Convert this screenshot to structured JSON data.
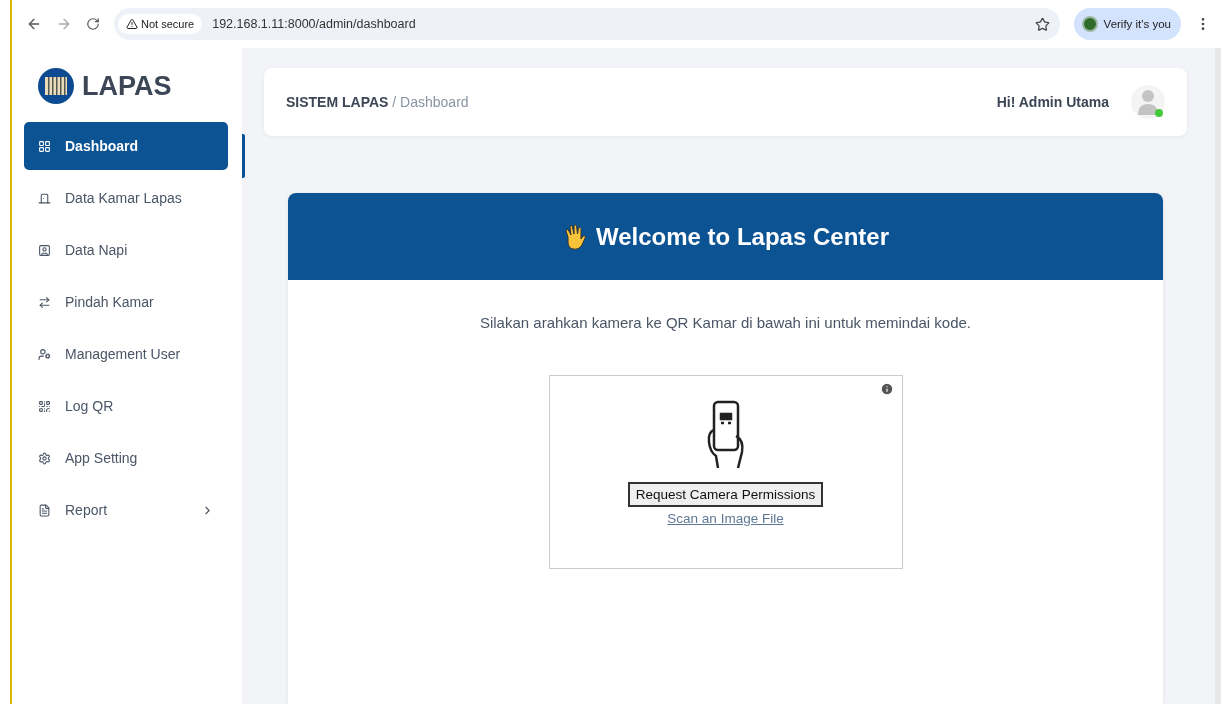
{
  "browser": {
    "security": "Not secure",
    "url": "192.168.1.11:8000/admin/dashboard",
    "profile": "Verify it's you"
  },
  "sidebar": {
    "brand": "LAPAS",
    "items": [
      {
        "label": "Dashboard",
        "selected": true,
        "kind": "link"
      },
      {
        "label": "Data Kamar Lapas",
        "selected": false,
        "kind": "link"
      },
      {
        "label": "Data Napi",
        "selected": false,
        "kind": "link"
      },
      {
        "label": "Pindah Kamar",
        "selected": false,
        "kind": "link"
      },
      {
        "label": "Management User",
        "selected": false,
        "kind": "link"
      },
      {
        "label": "Log QR",
        "selected": false,
        "kind": "link"
      },
      {
        "label": "App Setting",
        "selected": false,
        "kind": "link"
      },
      {
        "label": "Report",
        "selected": false,
        "kind": "submenu"
      }
    ]
  },
  "header": {
    "breadcrumb_root": "SISTEM LAPAS",
    "breadcrumb_separator": "/",
    "breadcrumb_current": "Dashboard",
    "greeting": "Hi! Admin Utama",
    "online": true
  },
  "welcome": {
    "title": "Welcome to Lapas Center",
    "instruction": "Silakan arahkan kamera ke QR Kamar di bawah ini untuk memindai kode.",
    "scanner": {
      "button": "Request Camera Permissions",
      "link": "Scan an Image File"
    }
  }
}
